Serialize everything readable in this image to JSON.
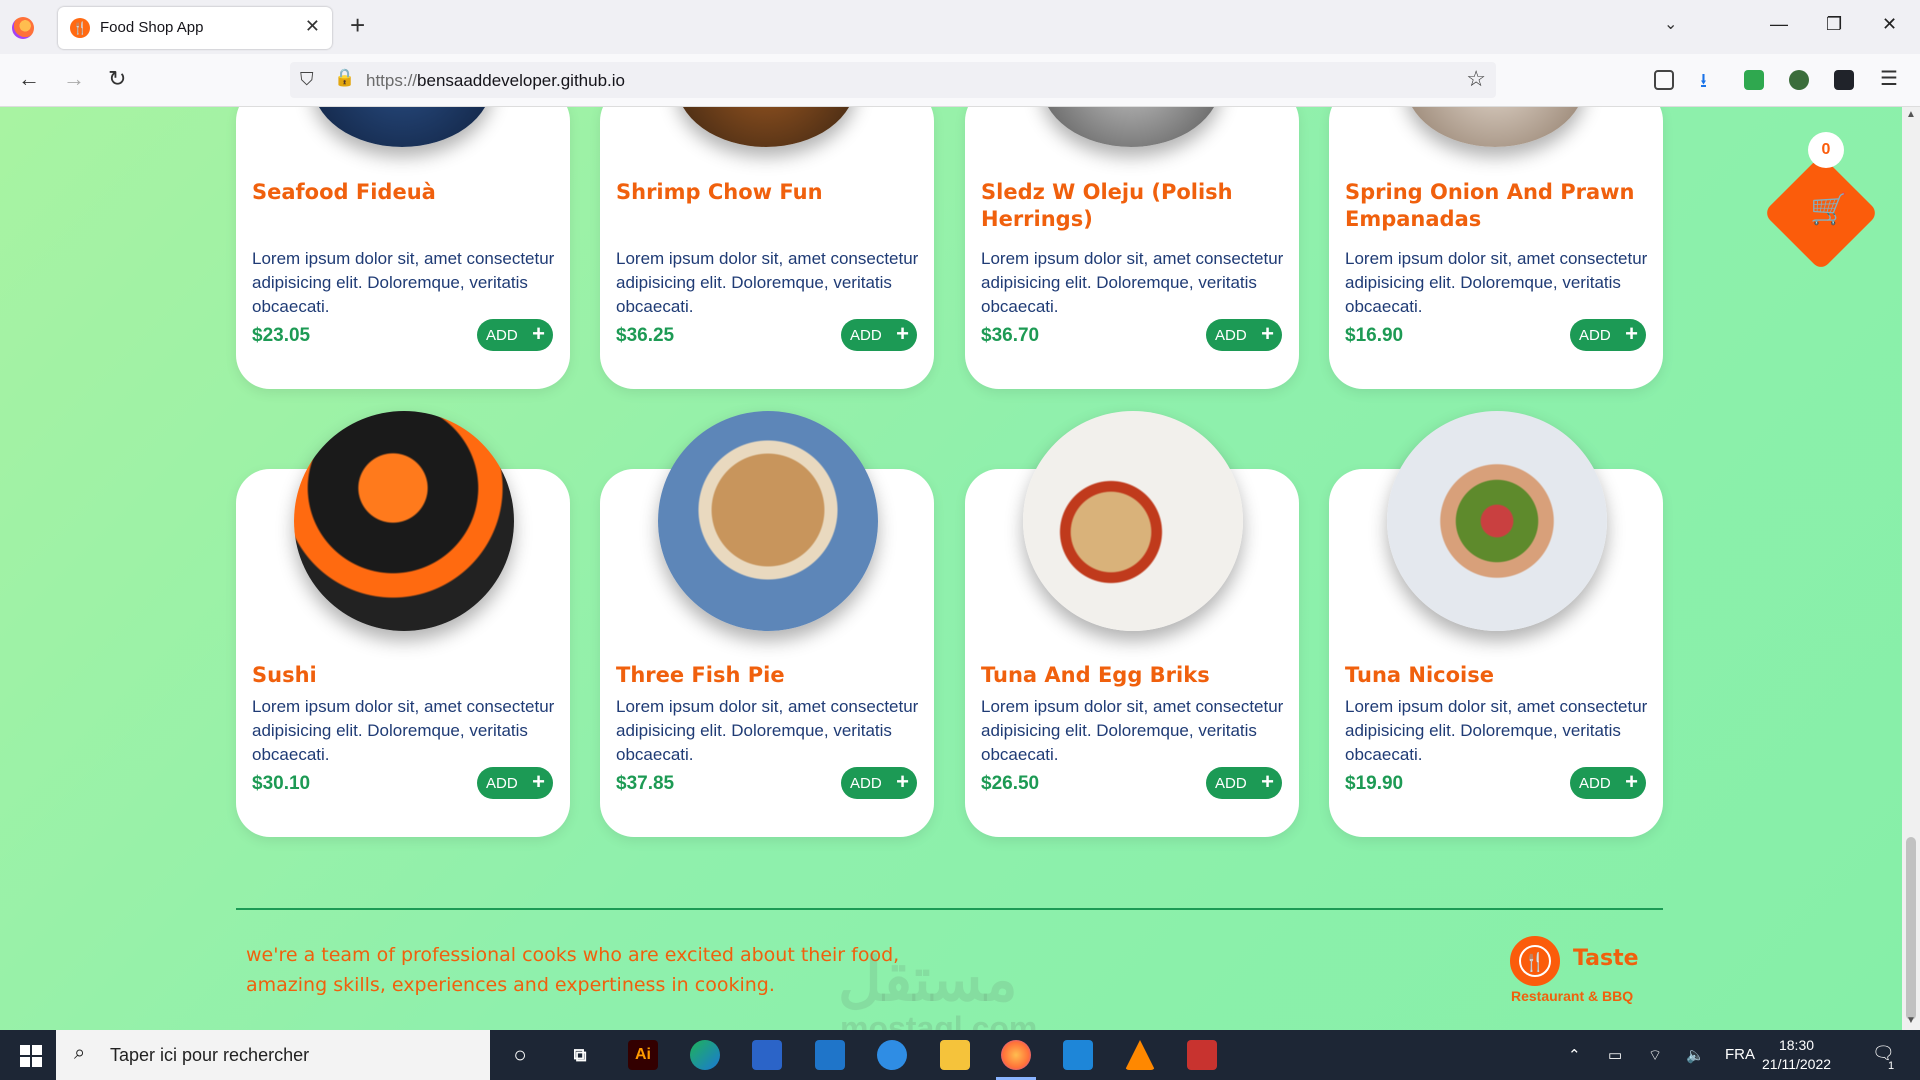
{
  "browser": {
    "tab_title": "Food Shop App",
    "url_protocol": "https://",
    "url_host": "bensaaddeveloper.github.io"
  },
  "cart": {
    "count": "0"
  },
  "menu": {
    "add_label": "ADD",
    "items": [
      {
        "name": "Seafood Fideuà",
        "desc": "Lorem ipsum dolor sit, amet consectetur adipisicing elit. Doloremque, veritatis obcaecati.",
        "price": "$23.05"
      },
      {
        "name": "Shrimp Chow Fun",
        "desc": "Lorem ipsum dolor sit, amet consectetur adipisicing elit. Doloremque, veritatis obcaecati.",
        "price": "$36.25"
      },
      {
        "name": "Sledz W Oleju (Polish Herrings)",
        "desc": "Lorem ipsum dolor sit, amet consectetur adipisicing elit. Doloremque, veritatis obcaecati.",
        "price": "$36.70"
      },
      {
        "name": "Spring Onion And Prawn Empanadas",
        "desc": "Lorem ipsum dolor sit, amet consectetur adipisicing elit. Doloremque, veritatis obcaecati.",
        "price": "$16.90"
      },
      {
        "name": "Sushi",
        "desc": "Lorem ipsum dolor sit, amet consectetur adipisicing elit. Doloremque, veritatis obcaecati.",
        "price": "$30.10"
      },
      {
        "name": "Three Fish Pie",
        "desc": "Lorem ipsum dolor sit, amet consectetur adipisicing elit. Doloremque, veritatis obcaecati.",
        "price": "$37.85"
      },
      {
        "name": "Tuna And Egg Briks",
        "desc": "Lorem ipsum dolor sit, amet consectetur adipisicing elit. Doloremque, veritatis obcaecati.",
        "price": "$26.50"
      },
      {
        "name": "Tuna Nicoise",
        "desc": "Lorem ipsum dolor sit, amet consectetur adipisicing elit. Doloremque, veritatis obcaecati.",
        "price": "$19.90"
      }
    ]
  },
  "footer": {
    "tagline": "we're a team of professional cooks who are excited about their food, amazing skills, experiences and expertiness in cooking.",
    "brand": "Taste",
    "brand_sub": "Restaurant & BBQ"
  },
  "taskbar": {
    "search_placeholder": "Taper ici pour rechercher",
    "language": "FRA",
    "time": "18:30",
    "date": "21/11/2022",
    "notification_count": "1"
  },
  "watermark": {
    "text": "مستقل",
    "site": "mostaql.com"
  },
  "colors": {
    "accent_orange": "#f0600d",
    "accent_green": "#1c9a55",
    "title_blue": "#1f3b75"
  }
}
